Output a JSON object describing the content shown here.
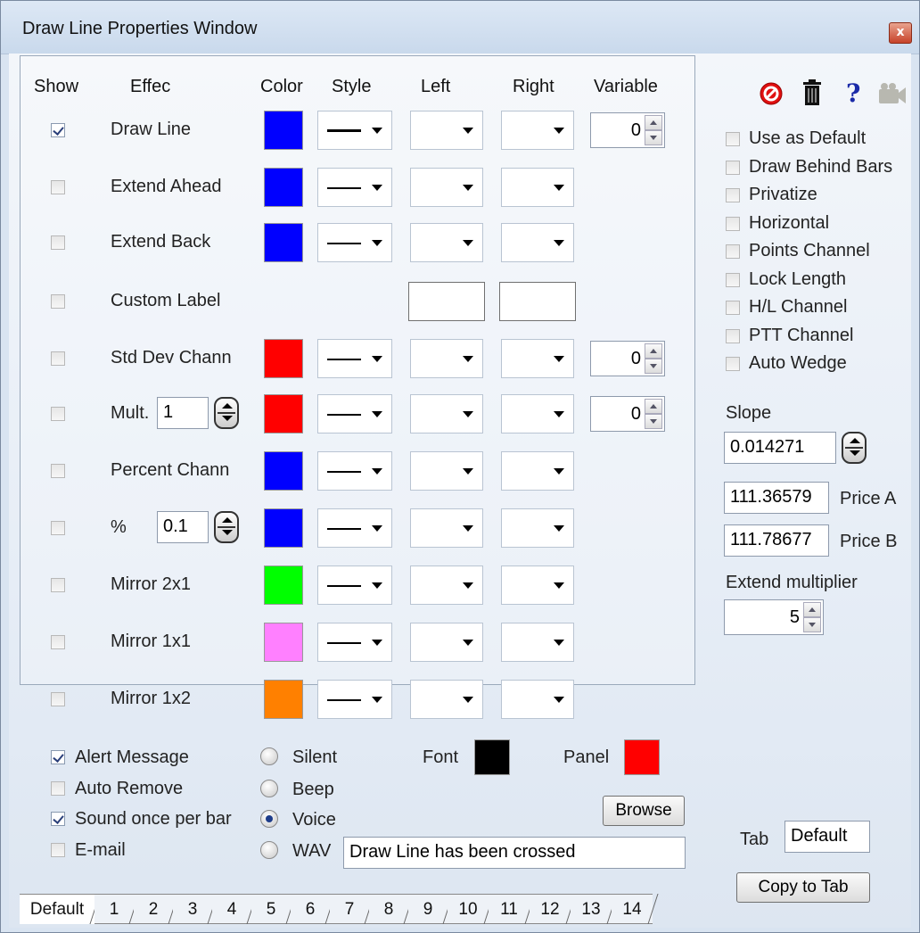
{
  "window": {
    "title": "Draw Line Properties Window",
    "close_glyph": "x"
  },
  "headers": {
    "show": "Show",
    "effect": "Effec",
    "color": "Color",
    "style": "Style",
    "left": "Left",
    "right": "Right",
    "variable": "Variable"
  },
  "rows": [
    {
      "label": "Draw Line",
      "checked": true,
      "color": "#0000ff",
      "style": "thick",
      "variable": "0"
    },
    {
      "label": "Extend Ahead",
      "checked": false,
      "color": "#0000ff",
      "style": "thin"
    },
    {
      "label": "Extend Back",
      "checked": false,
      "color": "#0000ff",
      "style": "thin"
    },
    {
      "label": "Custom Label",
      "checked": false
    },
    {
      "label": "Std Dev Chann",
      "checked": false,
      "color": "#ff0000",
      "style": "thin",
      "variable": "0"
    },
    {
      "label": "Mult.",
      "checked": false,
      "value": "1",
      "color": "#ff0000",
      "style": "thin",
      "variable": "0"
    },
    {
      "label": "Percent Chann",
      "checked": false,
      "color": "#0000ff",
      "style": "thin"
    },
    {
      "label": "%",
      "checked": false,
      "value": "0.1",
      "color": "#0000ff",
      "style": "thin"
    },
    {
      "label": "Mirror 2x1",
      "checked": false,
      "color": "#00ff00",
      "style": "thin"
    },
    {
      "label": "Mirror 1x1",
      "checked": false,
      "color": "#ff80ff",
      "style": "thin"
    },
    {
      "label": "Mirror 1x2",
      "checked": false,
      "color": "#ff8000",
      "style": "thin"
    }
  ],
  "alerts": {
    "alert_message": "Alert Message",
    "auto_remove": "Auto Remove",
    "sound_once": "Sound once per bar",
    "email": "E-mail",
    "silent": "Silent",
    "beep": "Beep",
    "voice": "Voice",
    "wav": "WAV",
    "font_label": "Font",
    "font_color": "#000000",
    "panel_label": "Panel",
    "panel_color": "#ff0000",
    "browse": "Browse",
    "wav_text": "Draw Line has been crossed"
  },
  "options": [
    "Use as Default",
    "Draw Behind Bars",
    "Privatize",
    "Horizontal",
    "Points Channel",
    "Lock Length",
    "H/L Channel",
    "PTT Channel",
    "Auto Wedge"
  ],
  "slope": {
    "label": "Slope",
    "value": "0.014271"
  },
  "price_a": {
    "value": "111.36579",
    "label": "Price A"
  },
  "price_b": {
    "value": "111.78677",
    "label": "Price B"
  },
  "extend": {
    "label": "Extend multiplier",
    "value": "5"
  },
  "tab_field": {
    "label": "Tab",
    "value": "Default"
  },
  "copy_to_tab": "Copy to Tab",
  "tabs": [
    "Default",
    "1",
    "2",
    "3",
    "4",
    "5",
    "6",
    "7",
    "8",
    "9",
    "10",
    "11",
    "12",
    "13",
    "14"
  ],
  "toolbar_icons": [
    "cancel-icon",
    "trash-icon",
    "help-icon",
    "camera-icon"
  ]
}
